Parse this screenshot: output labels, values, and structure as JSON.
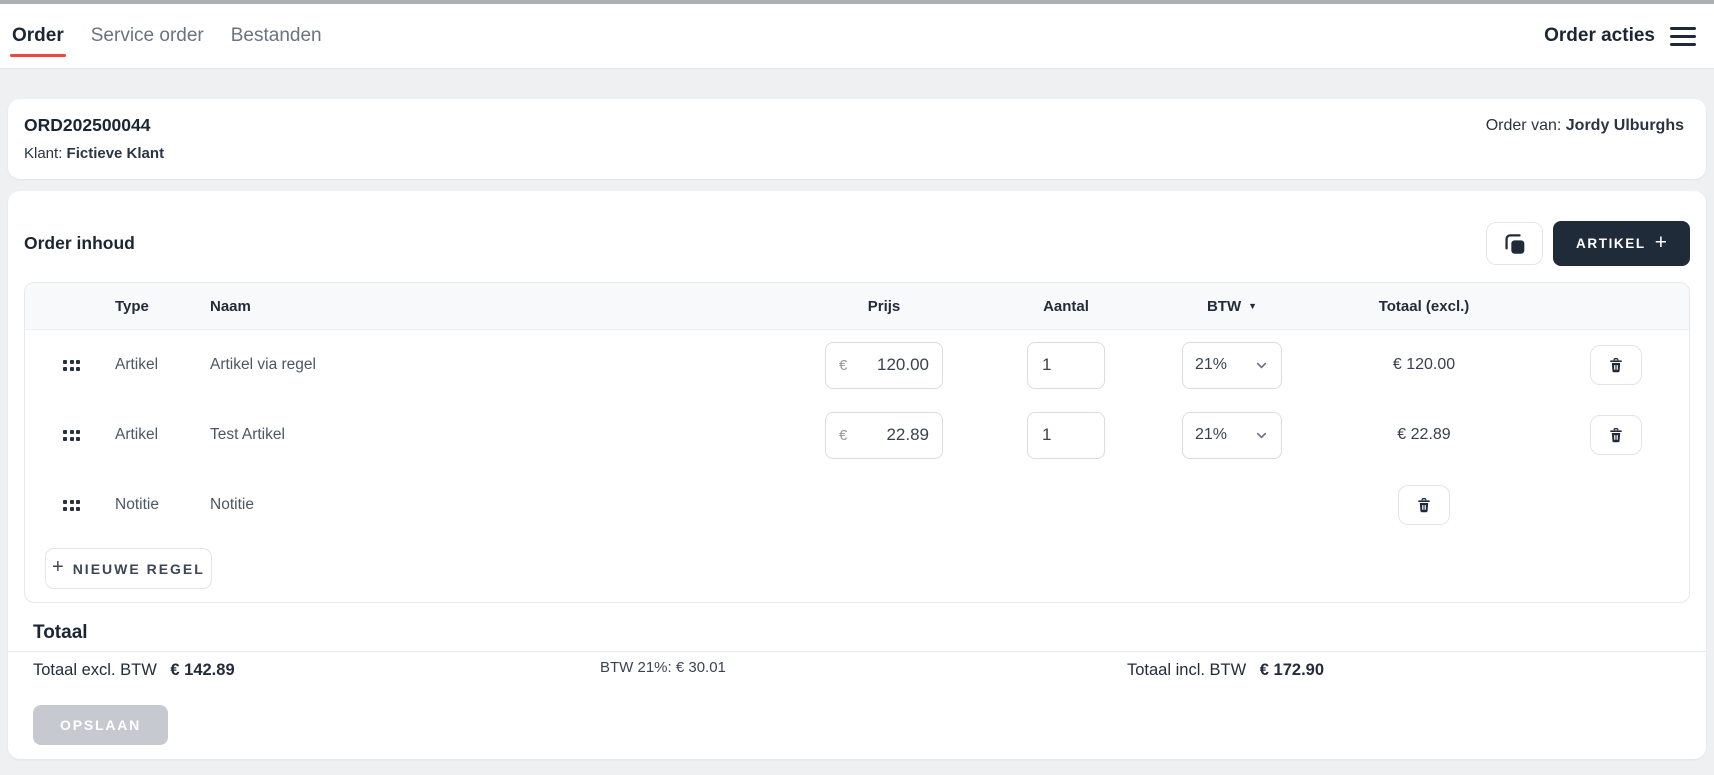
{
  "nav": {
    "tabs": [
      {
        "label": "Order",
        "active": true
      },
      {
        "label": "Service order",
        "active": false
      },
      {
        "label": "Bestanden",
        "active": false
      }
    ],
    "actions_label": "Order acties"
  },
  "order_header": {
    "order_number": "ORD202500044",
    "klant_label": "Klant:",
    "klant_value": "Fictieve Klant",
    "order_van_label": "Order van:",
    "order_van_value": "Jordy Ulburghs"
  },
  "order_content": {
    "title": "Order inhoud",
    "artikel_button_label": "ARTIKEL",
    "artikel_button_plus": "+",
    "table": {
      "headers": {
        "type": "Type",
        "naam": "Naam",
        "prijs": "Prijs",
        "aantal": "Aantal",
        "btw": "BTW",
        "btw_sort_icon": "▼",
        "totaal": "Totaal (excl.)"
      },
      "rows": [
        {
          "type": "Artikel",
          "naam": "Artikel via regel",
          "currency": "€",
          "prijs": "120.00",
          "aantal": "1",
          "btw": "21%",
          "totaal": "€ 120.00"
        },
        {
          "type": "Artikel",
          "naam": "Test Artikel",
          "currency": "€",
          "prijs": "22.89",
          "aantal": "1",
          "btw": "21%",
          "totaal": "€ 22.89"
        },
        {
          "type": "Notitie",
          "naam": "Notitie"
        }
      ]
    },
    "nieuwe_regel_plus": "+",
    "nieuwe_regel_label": "NIEUWE REGEL"
  },
  "totals": {
    "title": "Totaal",
    "excl_label": "Totaal excl. BTW",
    "excl_value": "€ 142.89",
    "btw_line": "BTW 21%: € 30.01",
    "incl_label": "Totaal incl. BTW",
    "incl_value": "€ 172.90",
    "save_label": "OPSLAAN"
  },
  "colors": {
    "accent_red": "#ef4444",
    "dark_navy": "#202b3a",
    "page_background": "#eef0f2",
    "disabled_button": "#c6c9cf"
  }
}
